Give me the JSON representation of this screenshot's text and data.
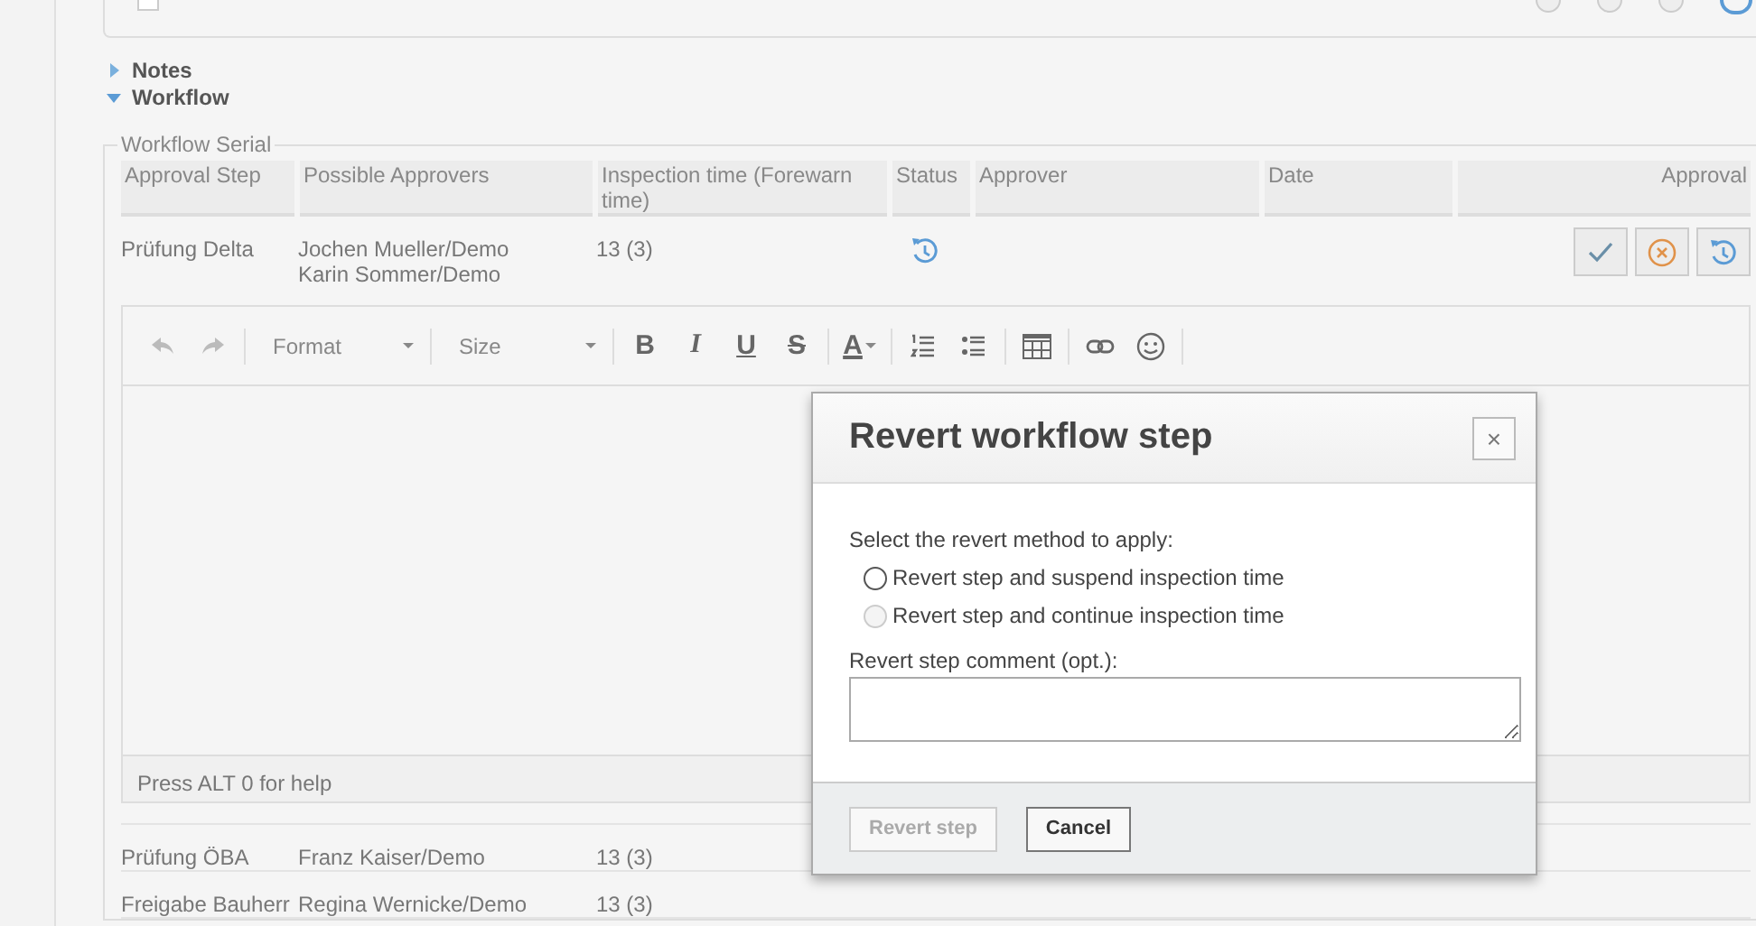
{
  "top_card": {
    "checkbox": {
      "checked": false
    },
    "radios": [
      {
        "selected": false
      },
      {
        "selected": false
      },
      {
        "selected": false
      }
    ]
  },
  "sections": [
    {
      "label": "Notes",
      "expanded": false
    },
    {
      "label": "Workflow",
      "expanded": true
    }
  ],
  "workflow": {
    "legend": "Workflow Serial",
    "columns": [
      "Approval Step",
      "Possible Approvers",
      "Inspection time (Forewarn time)",
      "Status",
      "Approver",
      "Date",
      "Approval"
    ],
    "rows": [
      {
        "step": "Prüfung Delta",
        "approvers": [
          "Jochen Mueller/Demo",
          "Karin Sommer/Demo"
        ],
        "time": "13 (3)",
        "reverted": true,
        "actions": [
          {
            "kind": "approve"
          },
          {
            "kind": "reject"
          },
          {
            "kind": "revert"
          }
        ],
        "editor": {
          "toolbar": [
            {
              "kind": "undo",
              "disabled": true
            },
            {
              "kind": "redo",
              "disabled": true
            },
            {
              "kind": "sep"
            },
            {
              "kind": "dropdown",
              "label": "Format",
              "disabled": false
            },
            {
              "kind": "sep"
            },
            {
              "kind": "dropdown",
              "label": "Size",
              "disabled": false
            },
            {
              "kind": "sep"
            },
            {
              "kind": "bold",
              "label": "B",
              "disabled": false
            },
            {
              "kind": "italic",
              "label": "I",
              "disabled": false
            },
            {
              "kind": "underline",
              "label": "U",
              "disabled": false
            },
            {
              "kind": "strike",
              "label": "S",
              "disabled": false
            },
            {
              "kind": "sep"
            },
            {
              "kind": "color",
              "label": "A",
              "disabled": false
            },
            {
              "kind": "sep"
            },
            {
              "kind": "ol",
              "disabled": false
            },
            {
              "kind": "ul",
              "disabled": false
            },
            {
              "kind": "sep"
            },
            {
              "kind": "table",
              "disabled": false
            },
            {
              "kind": "sep"
            },
            {
              "kind": "link",
              "disabled": false
            },
            {
              "kind": "emoji",
              "disabled": false
            },
            {
              "kind": "sep"
            }
          ],
          "status": "Press ALT 0 for help"
        }
      },
      {
        "step": "Prüfung ÖBA",
        "approvers": [
          "Franz Kaiser/Demo"
        ],
        "time": "13 (3)",
        "reverted": false,
        "actions": []
      },
      {
        "step": "Freigabe Bauherr",
        "approvers": [
          "Regina Wernicke/Demo"
        ],
        "time": "13 (3)",
        "reverted": false,
        "actions": []
      }
    ]
  },
  "dialog": {
    "title": "Revert workflow step",
    "close": "×",
    "prompt": "Select the revert method to apply:",
    "options": [
      {
        "label": "Revert step and suspend inspection time",
        "selected": false,
        "disabled": false
      },
      {
        "label": "Revert step and continue inspection time",
        "selected": false,
        "disabled": true
      }
    ],
    "comment_label": "Revert step comment (opt.):",
    "buttons": [
      {
        "label": "Revert step",
        "disabled": true
      },
      {
        "label": "Cancel",
        "disabled": false
      }
    ]
  }
}
